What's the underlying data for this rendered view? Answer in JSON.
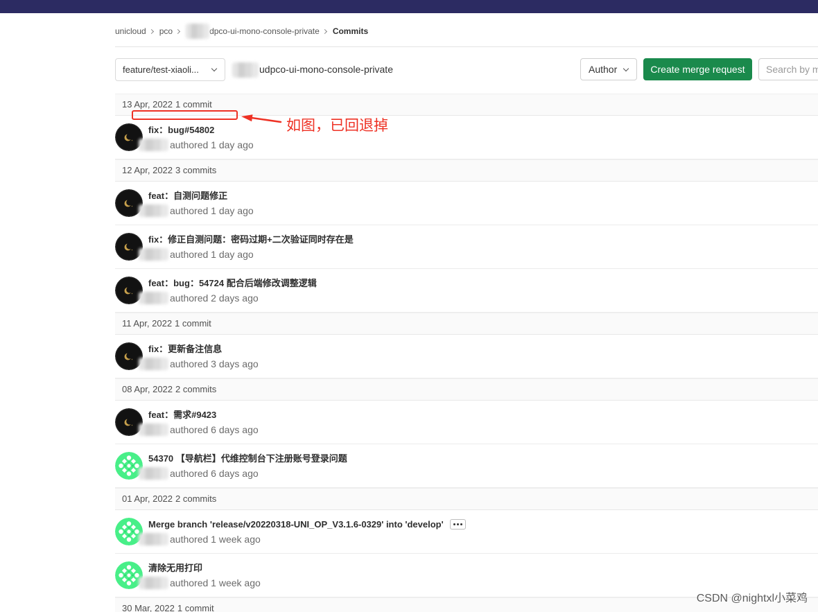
{
  "colors": {
    "topbar": "#2c2b62",
    "primary_green": "#1a8a4c",
    "annotation_red": "#ee3124",
    "group_header_bg": "#fafafa"
  },
  "breadcrumb": {
    "items": [
      "unicloud",
      "pco",
      "dpco-ui-mono-console-private"
    ],
    "current": "Commits"
  },
  "toolbar": {
    "branch": "feature/test-xiaoli...",
    "project_path": "udpco-ui-mono-console-private",
    "author_label": "Author",
    "create_mr_label": "Create merge request",
    "search_placeholder": "Search by m"
  },
  "groups": [
    {
      "date": "13 Apr, 2022",
      "count": "1 commit",
      "commits": [
        {
          "title": "fix：bug#54802",
          "meta": "authored 1 day ago",
          "avatar_icon": "moon-avatar"
        }
      ]
    },
    {
      "date": "12 Apr, 2022",
      "count": "3 commits",
      "commits": [
        {
          "title": "feat：自测问题修正",
          "meta": "authored 1 day ago",
          "avatar_icon": "moon-avatar"
        },
        {
          "title": "fix：修正自测问题：密码过期+二次验证同时存在是",
          "meta": "authored 1 day ago",
          "avatar_icon": "moon-avatar"
        },
        {
          "title": "feat：bug：54724 配合后端修改调整逻辑",
          "meta": "authored 2 days ago",
          "avatar_icon": "moon-avatar"
        }
      ]
    },
    {
      "date": "11 Apr, 2022",
      "count": "1 commit",
      "commits": [
        {
          "title": "fix：更新备注信息",
          "meta": "authored 3 days ago",
          "avatar_icon": "moon-avatar"
        }
      ]
    },
    {
      "date": "08 Apr, 2022",
      "count": "2 commits",
      "commits": [
        {
          "title": "feat：需求#9423",
          "meta": "authored 6 days ago",
          "avatar_icon": "moon-avatar"
        },
        {
          "title": "54370 【导航栏】代维控制台下注册账号登录问题",
          "meta": "authored 6 days ago",
          "avatar_icon": "identicon-avatar"
        }
      ]
    },
    {
      "date": "01 Apr, 2022",
      "count": "2 commits",
      "commits": [
        {
          "title": "Merge branch 'release/v20220318-UNI_OP_V3.1.6-0329' into 'develop'",
          "meta": "authored 1 week ago",
          "avatar_icon": "identicon-avatar",
          "toggle_icon": "ellipsis-icon"
        },
        {
          "title": "清除无用打印",
          "meta": "authored 1 week ago",
          "avatar_icon": "identicon-avatar"
        }
      ]
    },
    {
      "date": "30 Mar, 2022",
      "count": "1 commit",
      "commits": []
    }
  ],
  "annotation": {
    "text": "如图，已回退掉"
  },
  "watermark": "CSDN @nightxl小菜鸡"
}
